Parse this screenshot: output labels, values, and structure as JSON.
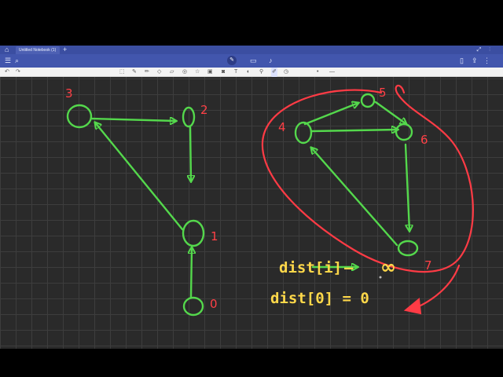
{
  "tabs": [
    {
      "label": "Untitled Notebook (1)"
    }
  ],
  "graph": {
    "node_labels": [
      "0",
      "1",
      "2",
      "3",
      "4",
      "5",
      "6",
      "7"
    ]
  },
  "notes": {
    "dist_i": "dist[i]",
    "arrow_text": "—",
    "infinity": "∞",
    "dist_0": "dist[0] = 0"
  },
  "colors": {
    "edge_green": "#54d84c",
    "label_red": "#ff4046",
    "note_yellow": "#ffd84a",
    "ribbon_blue": "#4256ad",
    "grid_bg": "#2a2a2a"
  },
  "icons": [
    "home-icon",
    "undo-icon",
    "redo-icon",
    "search-icon",
    "pen-icon",
    "mic-icon",
    "share-icon",
    "lasso-icon",
    "eraser-icon",
    "highlighter-icon",
    "shapes-icon",
    "image-icon",
    "timer-icon"
  ]
}
